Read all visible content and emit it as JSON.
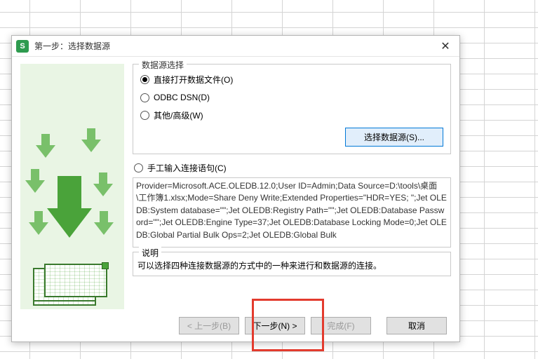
{
  "titlebar": {
    "icon_letter": "S",
    "title": "第一步：选择数据源"
  },
  "group1": {
    "label": "数据源选择",
    "options": {
      "open_file": "直接打开数据文件(O)",
      "odbc": "ODBC DSN(D)",
      "other": "其他/高级(W)"
    },
    "select_button": "选择数据源(S)..."
  },
  "manual": {
    "label": "手工输入连接语句(C)",
    "connection_string": "Provider=Microsoft.ACE.OLEDB.12.0;User ID=Admin;Data Source=D:\\tools\\桌面\\工作簿1.xlsx;Mode=Share Deny Write;Extended Properties=\"HDR=YES; \";Jet OLEDB:System database=\"\";Jet OLEDB:Registry Path=\"\";Jet OLEDB:Database Password=\"\";Jet OLEDB:Engine Type=37;Jet OLEDB:Database Locking Mode=0;Jet OLEDB:Global Partial Bulk Ops=2;Jet OLEDB:Global Bulk"
  },
  "description": {
    "label": "说明",
    "text": "可以选择四种连接数据源的方式中的一种来进行和数据源的连接。"
  },
  "footer": {
    "back": "< 上一步(B)",
    "next": "下一步(N) >",
    "finish": "完成(F)",
    "cancel": "取消"
  }
}
